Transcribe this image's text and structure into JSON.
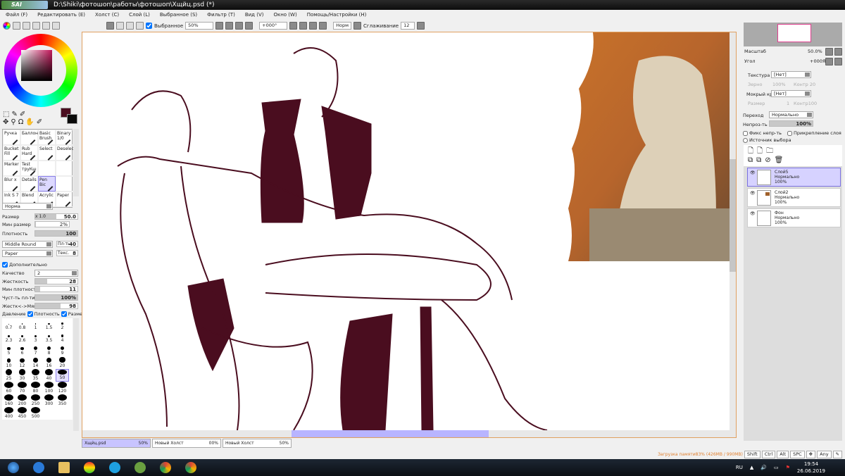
{
  "window": {
    "app_logo": "PaintTool SAI",
    "title": "D:\\Shiki\\фотошоп\\работы\\фотошоп\\Хщйц.psd (*)"
  },
  "menu": [
    "Файл (F)",
    "Редактировать (E)",
    "Холст (C)",
    "Слой (L)",
    "Выбранное (S)",
    "Фильтр (T)",
    "Вид (V)",
    "Окно (W)",
    "Помощь/Настройки (H)"
  ],
  "toolbar": {
    "selection_label": "Выбранное",
    "selection_checked": true,
    "zoom": "50%",
    "angle": "+000°",
    "mode": "Норм",
    "smoothing_label": "Сглаживание",
    "smoothing": "12"
  },
  "colors": {
    "primary": "#4a0d1f",
    "secondary": "#0a0a0a",
    "line": "#4a0d1f",
    "accent": "#c8c4ff"
  },
  "tools": [
    {
      "label": "Ручка"
    },
    {
      "label": "Баллон"
    },
    {
      "label": "Basic Brush"
    },
    {
      "label": "Binary 1/0"
    },
    {
      "label": "Bucket Fill"
    },
    {
      "label": "Rub Hard"
    },
    {
      "label": "Select"
    },
    {
      "label": "Deselect"
    },
    {
      "label": "Marker"
    },
    {
      "label": "Test труКш"
    },
    {
      "label": ""
    },
    {
      "label": ""
    },
    {
      "label": "Blur x"
    },
    {
      "label": "Details"
    },
    {
      "label": "Pen Bic",
      "selected": true
    },
    {
      "label": ""
    },
    {
      "label": "Ink S 7"
    },
    {
      "label": "Blend"
    },
    {
      "label": "Acrylic"
    },
    {
      "label": "Paper"
    }
  ],
  "brush": {
    "blend_mode": "Норма",
    "size_label": "Размер",
    "size_mult": "x 1.0",
    "size": "50.0",
    "min_size_label": "Мин размер",
    "min_size": "2%",
    "density_label": "Плотность",
    "density": "100",
    "shape": "Middle Round",
    "shape_strength_label": "Пл-ть",
    "shape_strength": "40",
    "texture": "Paper",
    "texture_strength_label": "Текс.",
    "texture_strength": "8",
    "advanced_label": "Дополнительно",
    "advanced_checked": true,
    "quality_label": "Качество",
    "quality": "2",
    "hardness_label": "Жесткость",
    "hardness": "28",
    "min_density_label": "Мин плотность",
    "min_density": "11",
    "sensitivity_label": "Чуст-ть пл-ти",
    "sensitivity": "100%",
    "hard_soft_label": "Жестк<->Мягк",
    "hard_soft": "98",
    "pressure_label": "Давление",
    "pressure_density": "Плотность",
    "pressure_size": "Размер"
  },
  "brush_sizes": [
    "0.7",
    "0.8",
    "1",
    "1.5",
    "2",
    "2.3",
    "2.6",
    "3",
    "3.5",
    "4",
    "5",
    "6",
    "7",
    "8",
    "9",
    "10",
    "12",
    "14",
    "16",
    "20",
    "25",
    "30",
    "35",
    "40",
    "50",
    "60",
    "70",
    "80",
    "100",
    "120",
    "160",
    "200",
    "250",
    "300",
    "350",
    "400",
    "450",
    "500"
  ],
  "selected_brush_size": "50",
  "navigator": {
    "zoom_label": "Масштаб",
    "zoom": "50.0%",
    "angle_label": "Угол",
    "angle": "+000Я"
  },
  "layer_props": {
    "texture_label": "Текстура",
    "texture": "[Нет]",
    "grain": "Зерно",
    "grain_val": "100%",
    "contrast": "Контр 20",
    "wet_label": "Мокрый край",
    "wet": "[Нет]",
    "wet_size": "Размер",
    "wet_size_val": "1",
    "wet_contrast": "Контр100",
    "blend_label": "Переход",
    "blend": "Нормально",
    "opacity_label": "Непроз-ть",
    "opacity": "100%",
    "lock_opacity": "Фикс непр-ть",
    "clip": "Прикрепление слоя",
    "selection_source": "Источник выбора"
  },
  "layers": [
    {
      "name": "Слой5",
      "mode": "Нормально",
      "opacity": "100%",
      "selected": true
    },
    {
      "name": "Слой2",
      "mode": "Нормально",
      "opacity": "100%"
    },
    {
      "name": "Фон",
      "mode": "Нормально",
      "opacity": "100%"
    }
  ],
  "tabs": [
    {
      "name": "Хщйц.psd",
      "zoom": "50%",
      "active": true
    },
    {
      "name": "Новый Холст",
      "zoom": "00%"
    },
    {
      "name": "Новый Холст",
      "zoom": "50%"
    }
  ],
  "status": {
    "memory": "Загрузка памяти83% (426MB / 990MB)",
    "keys": [
      "Shift",
      "Ctrl",
      "Alt",
      "SPC",
      "Any"
    ]
  },
  "taskbar": {
    "lang": "RU",
    "time": "19:54",
    "date": "26.06.2019"
  }
}
